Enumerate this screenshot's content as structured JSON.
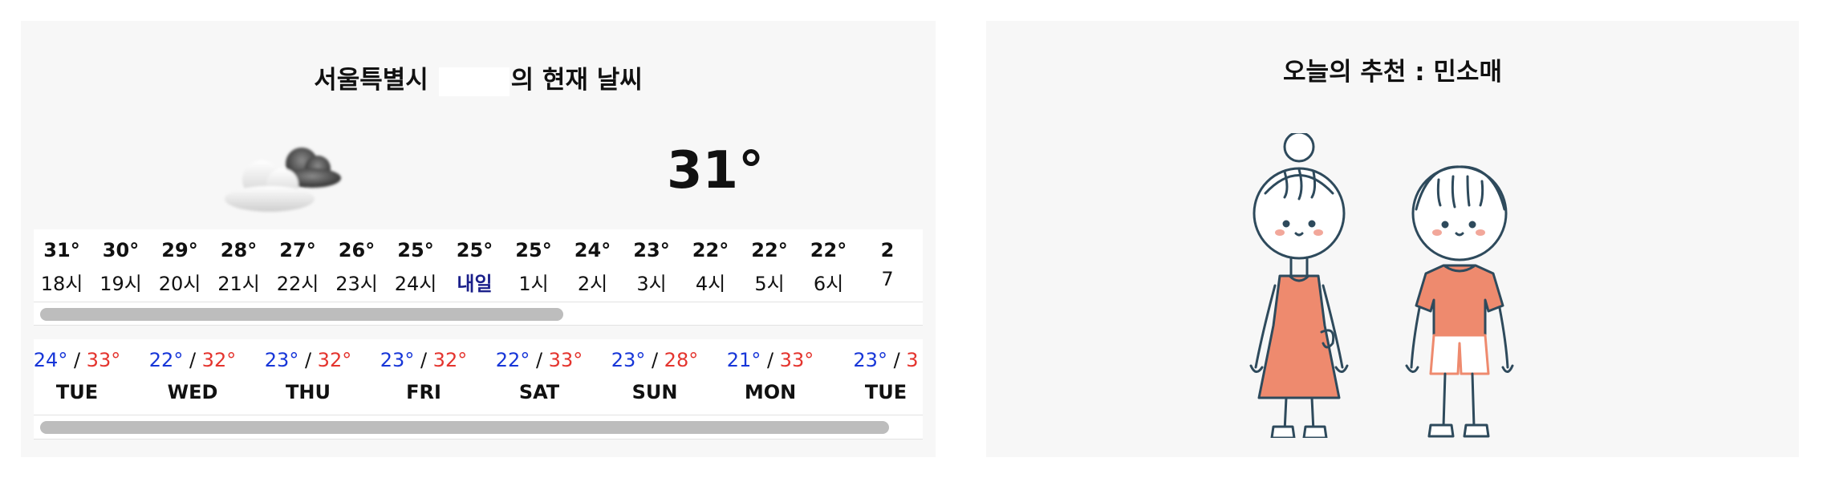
{
  "weather": {
    "title_prefix": "서울특별시",
    "title_suffix": "의 현재 날씨",
    "current_temp": "31°",
    "icon": "partly-cloudy-icon",
    "hourly": [
      {
        "temp": "31°",
        "label": "18시"
      },
      {
        "temp": "30°",
        "label": "19시"
      },
      {
        "temp": "29°",
        "label": "20시"
      },
      {
        "temp": "28°",
        "label": "21시"
      },
      {
        "temp": "27°",
        "label": "22시"
      },
      {
        "temp": "26°",
        "label": "23시"
      },
      {
        "temp": "25°",
        "label": "24시"
      },
      {
        "temp": "25°",
        "label": "내일"
      },
      {
        "temp": "25°",
        "label": "1시"
      },
      {
        "temp": "24°",
        "label": "2시"
      },
      {
        "temp": "23°",
        "label": "3시"
      },
      {
        "temp": "22°",
        "label": "4시"
      },
      {
        "temp": "22°",
        "label": "5시"
      },
      {
        "temp": "22°",
        "label": "6시"
      },
      {
        "temp": "2",
        "label": "7"
      }
    ],
    "daily": [
      {
        "low": "24°",
        "high": "33°",
        "day": "TUE"
      },
      {
        "low": "22°",
        "high": "32°",
        "day": "WED"
      },
      {
        "low": "23°",
        "high": "32°",
        "day": "THU"
      },
      {
        "low": "23°",
        "high": "32°",
        "day": "FRI"
      },
      {
        "low": "22°",
        "high": "33°",
        "day": "SAT"
      },
      {
        "low": "23°",
        "high": "28°",
        "day": "SUN"
      },
      {
        "low": "21°",
        "high": "33°",
        "day": "MON"
      },
      {
        "low": "23°",
        "high": "3",
        "day": "TUE"
      }
    ],
    "separator": " / "
  },
  "recommendation": {
    "title": "오늘의 추천 : 민소매",
    "illustration": "kids-summer-outfit-illustration"
  },
  "colors": {
    "panel_bg": "#f7f7f7",
    "low_temp": "#1736d8",
    "high_temp": "#e4342e",
    "tomorrow_label": "#1a1f8a",
    "outfit_orange": "#ee8a6e",
    "outline": "#2e4a5c"
  }
}
